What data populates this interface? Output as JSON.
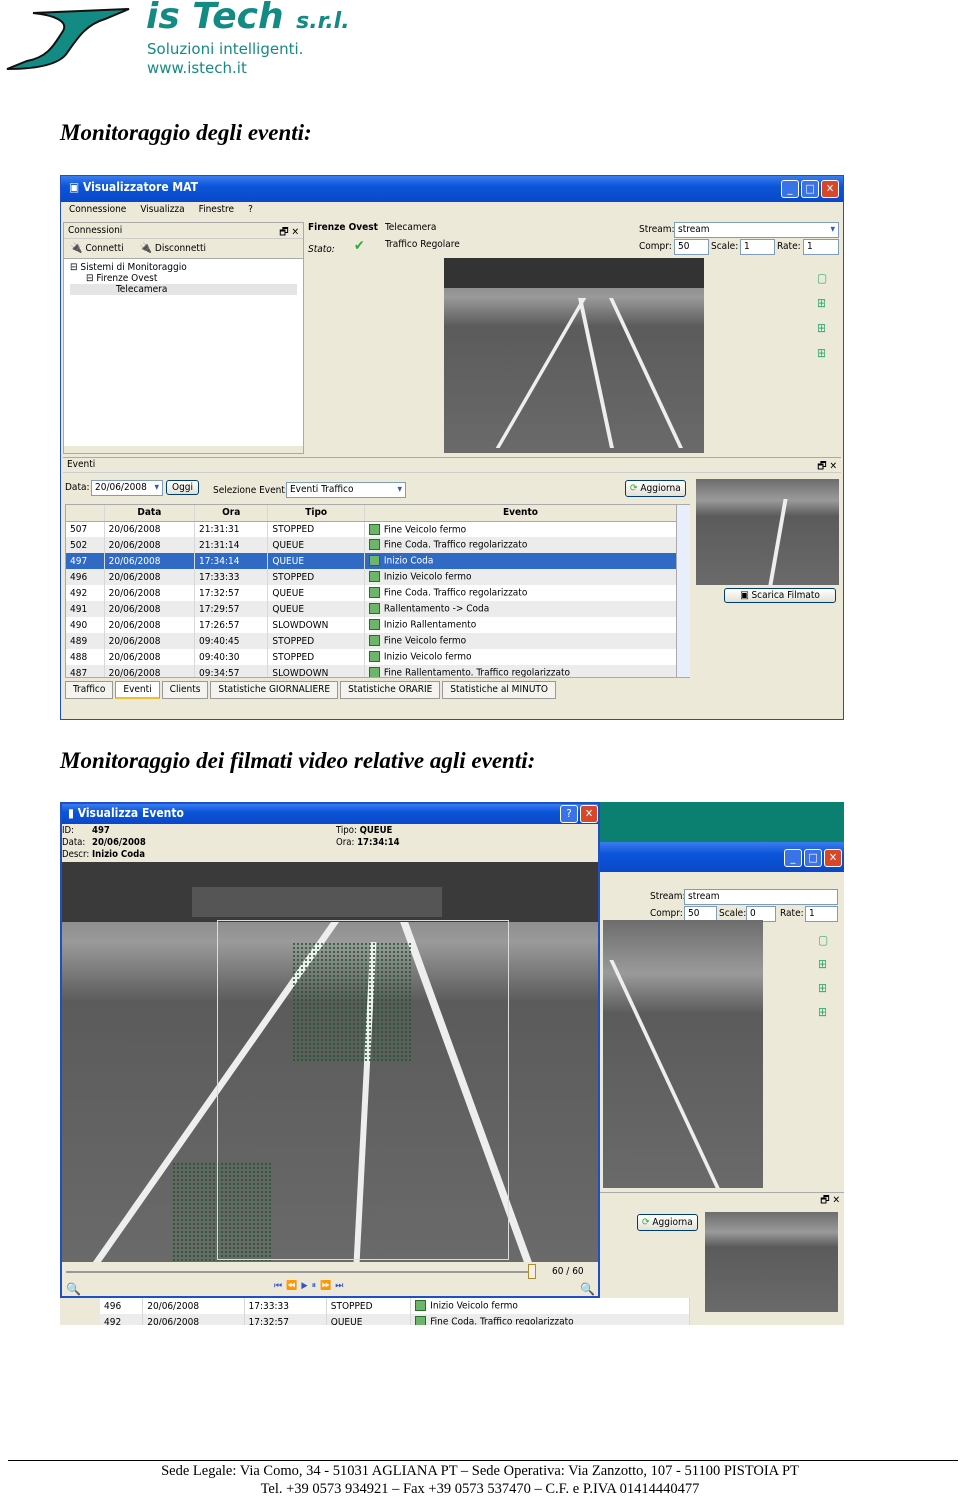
{
  "header": {
    "company": "is Tech",
    "suffix": "s.r.l.",
    "tagline": "Soluzioni intelligenti.",
    "website": "www.istech.it",
    "brand_color": "#138b84"
  },
  "section1": {
    "heading": "Monitoraggio degli eventi:"
  },
  "section2": {
    "heading": "Monitoraggio dei filmati video relative agli eventi:"
  },
  "app1": {
    "title": "Visualizzatore MAT",
    "menu": [
      "Connessione",
      "Visualizza",
      "Finestre",
      "?"
    ],
    "connections": {
      "title": "Connessioni",
      "connect": "Connetti",
      "disconnect": "Disconnetti",
      "tree": [
        "Sistemi di Monitoraggio",
        "Firenze Ovest",
        "Telecamera"
      ]
    },
    "camera": {
      "site": "Firenze Ovest",
      "camera": "Telecamera",
      "status_label": "Stato:",
      "status": "Traffico Regolare",
      "stream_label": "Stream:",
      "stream": "stream",
      "compr_label": "Compr:",
      "compr": "50",
      "scale_label": "Scale:",
      "scale": "1",
      "rate_label": "Rate:",
      "rate": "1"
    },
    "events": {
      "title": "Eventi",
      "date_label": "Data:",
      "date": "20/06/2008",
      "today": "Oggi",
      "select_label": "Selezione Event:",
      "select": "Eventi Traffico",
      "refresh": "Aggiorna",
      "download": "Scarica Filmato",
      "columns": [
        "",
        "Data",
        "Ora",
        "Tipo",
        "Evento"
      ],
      "rows": [
        [
          "507",
          "20/06/2008",
          "21:31:31",
          "STOPPED",
          "Fine Veicolo fermo"
        ],
        [
          "502",
          "20/06/2008",
          "21:31:14",
          "QUEUE",
          "Fine Coda. Traffico regolarizzato"
        ],
        [
          "497",
          "20/06/2008",
          "17:34:14",
          "QUEUE",
          "Inizio Coda"
        ],
        [
          "496",
          "20/06/2008",
          "17:33:33",
          "STOPPED",
          "Inizio Veicolo fermo"
        ],
        [
          "492",
          "20/06/2008",
          "17:32:57",
          "QUEUE",
          "Fine Coda. Traffico regolarizzato"
        ],
        [
          "491",
          "20/06/2008",
          "17:29:57",
          "QUEUE",
          "Rallentamento -> Coda"
        ],
        [
          "490",
          "20/06/2008",
          "17:26:57",
          "SLOWDOWN",
          "Inizio Rallentamento"
        ],
        [
          "489",
          "20/06/2008",
          "09:40:45",
          "STOPPED",
          "Fine Veicolo fermo"
        ],
        [
          "488",
          "20/06/2008",
          "09:40:30",
          "STOPPED",
          "Inizio Veicolo fermo"
        ],
        [
          "487",
          "20/06/2008",
          "09:34:57",
          "SLOWDOWN",
          "Fine Rallentamento. Traffico regolarizzato"
        ]
      ],
      "selected_row": "497"
    },
    "tabs": [
      "Traffico",
      "Eventi",
      "Clients",
      "Statistiche GIORNALIERE",
      "Statistiche ORARIE",
      "Statistiche al MINUTO"
    ],
    "active_tab": "Eventi"
  },
  "app2": {
    "title": "Visualizza Evento",
    "id_label": "ID:",
    "id": "497",
    "date_label": "Data:",
    "date": "20/06/2008",
    "descr_label": "Descr:",
    "descr": "Inizio Coda",
    "type_label": "Tipo:",
    "type": "QUEUE",
    "time_label": "Ora:",
    "time": "17:34:14",
    "frame": "60 / 60",
    "progress": 1.0,
    "bg": {
      "stream_label": "Stream:",
      "stream": "stream",
      "compr_label": "Compr:",
      "compr": "50",
      "scale_label": "Scale:",
      "scale": "0",
      "rate_label": "Rate:",
      "rate": "1",
      "refresh": "Aggiorna",
      "rows": [
        [
          "496",
          "20/06/2008",
          "17:33:33",
          "STOPPED",
          "Inizio Veicolo fermo"
        ],
        [
          "492",
          "20/06/2008",
          "17:32:57",
          "QUEUE",
          "Fine Coda. Traffico regolarizzato"
        ]
      ]
    }
  },
  "footer": {
    "line1": "Sede Legale: Via Como, 34 - 51031 AGLIANA PT – Sede Operativa: Via Zanzotto, 107 - 51100 PISTOIA PT",
    "line2": "Tel. +39 0573 934921 – Fax +39 0573 537470 – C.F. e P.IVA 01414440477"
  }
}
